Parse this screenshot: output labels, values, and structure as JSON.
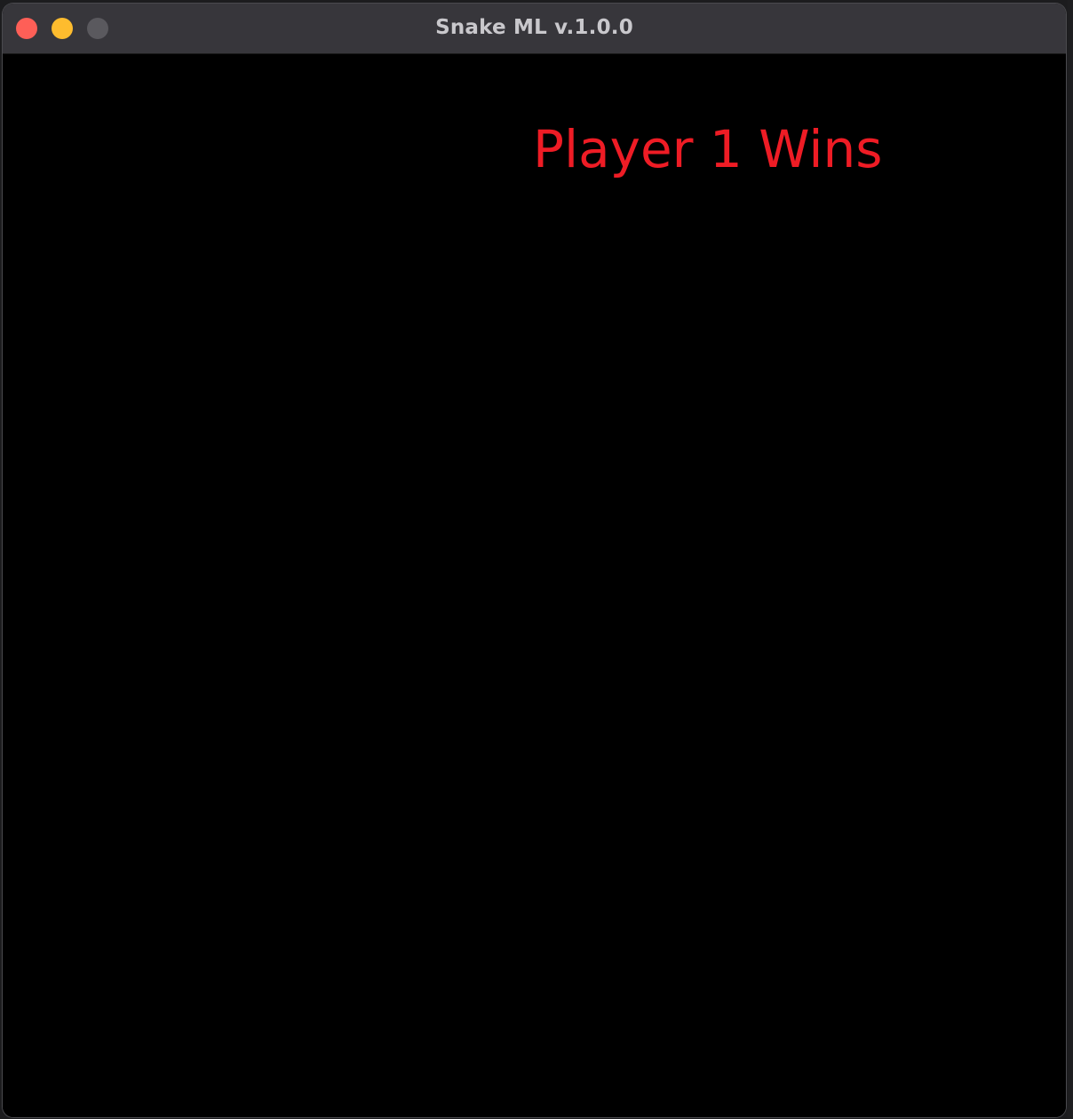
{
  "window": {
    "title": "Snake ML v.1.0.0"
  },
  "game": {
    "message": "Player 1 Wins",
    "message_color": "#ee1c25",
    "background_color": "#000000"
  },
  "controls": {
    "close_icon": "close-icon",
    "minimize_icon": "minimize-icon",
    "zoom_icon": "zoom-icon"
  }
}
